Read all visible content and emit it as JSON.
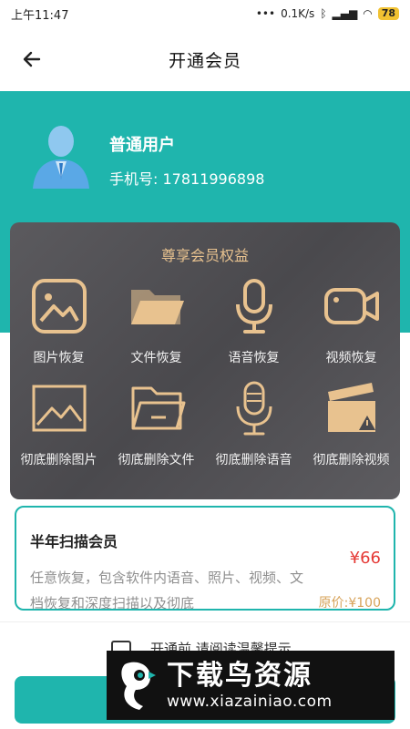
{
  "status_bar": {
    "time": "上午11:47",
    "network_speed": "0.1K/s",
    "battery": "78"
  },
  "header": {
    "title": "开通会员"
  },
  "profile": {
    "username": "普通用户",
    "phone": "手机号:  17811996898"
  },
  "benefits": {
    "title": "尊享会员权益",
    "items": [
      {
        "label": "图片恢复",
        "icon": "image-recovery-icon"
      },
      {
        "label": "文件恢复",
        "icon": "folder-recovery-icon"
      },
      {
        "label": "语音恢复",
        "icon": "microphone-recovery-icon"
      },
      {
        "label": "视频恢复",
        "icon": "video-camera-recovery-icon"
      },
      {
        "label": "彻底删除图片",
        "icon": "image-delete-icon"
      },
      {
        "label": "彻底删除文件",
        "icon": "folder-delete-icon"
      },
      {
        "label": "彻底删除语音",
        "icon": "microphone-delete-icon"
      },
      {
        "label": "彻底删除视频",
        "icon": "clapperboard-delete-icon"
      }
    ]
  },
  "plan": {
    "name": "半年扫描会员",
    "price": "¥66",
    "description": "任意恢复，包含软件内语音、照片、视频、文档恢复和深度扫描以及彻底",
    "original_price": "原价:¥100"
  },
  "agreement": {
    "text": "开通前 请阅读温馨提示"
  },
  "watermark": {
    "title": "下载鸟资源",
    "url": "www.xiazainiao.com"
  },
  "colors": {
    "teal": "#1fb5ad",
    "gold": "#e8c28f",
    "price_red": "#e53935"
  }
}
